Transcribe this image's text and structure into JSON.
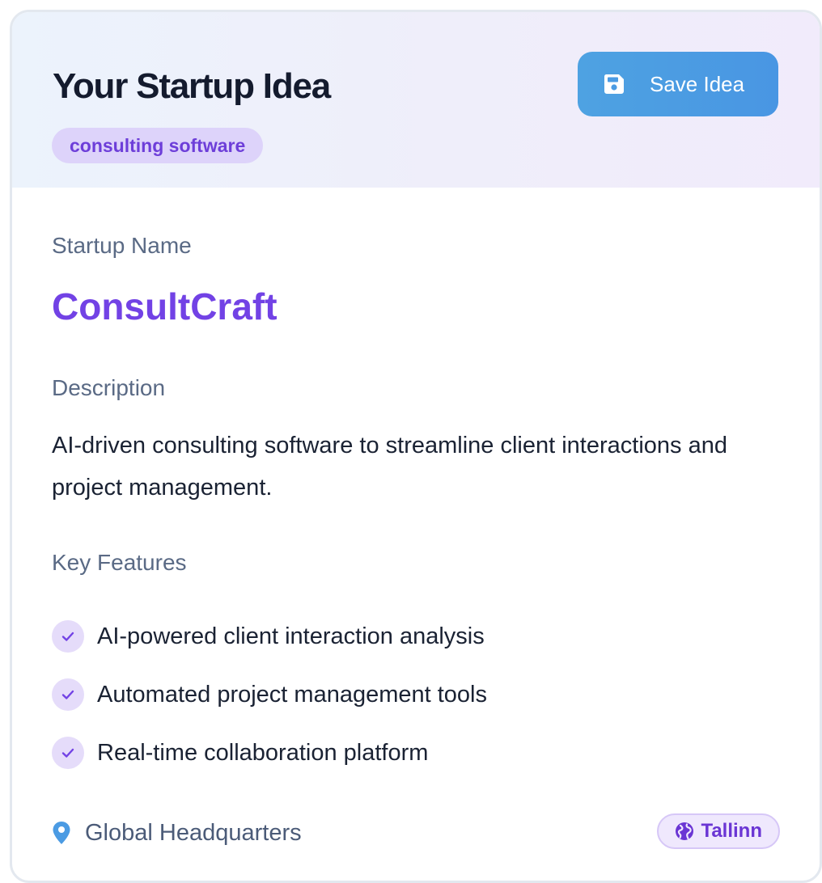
{
  "header": {
    "title": "Your Startup Idea",
    "category_tag": "consulting software",
    "save_button": {
      "label": "Save Idea",
      "icon": "floppy-disk-icon"
    }
  },
  "startup_name": {
    "label": "Startup Name",
    "value": "ConsultCraft"
  },
  "description": {
    "label": "Description",
    "text": "AI-driven consulting software to streamline client interactions and project management."
  },
  "key_features": {
    "label": "Key Features",
    "items": [
      "AI-powered client interaction analysis",
      "Automated project management tools",
      "Real-time collaboration platform"
    ],
    "icon": "check-icon"
  },
  "headquarters": {
    "label": "Global Headquarters",
    "icon": "map-pin-icon",
    "location": "Tallinn",
    "location_icon": "globe-icon"
  },
  "colors": {
    "accent_purple": "#7242e5",
    "button_blue": "#4a9ae3",
    "tag_bg": "#ddd3fa",
    "muted_text": "#5a6a85"
  }
}
